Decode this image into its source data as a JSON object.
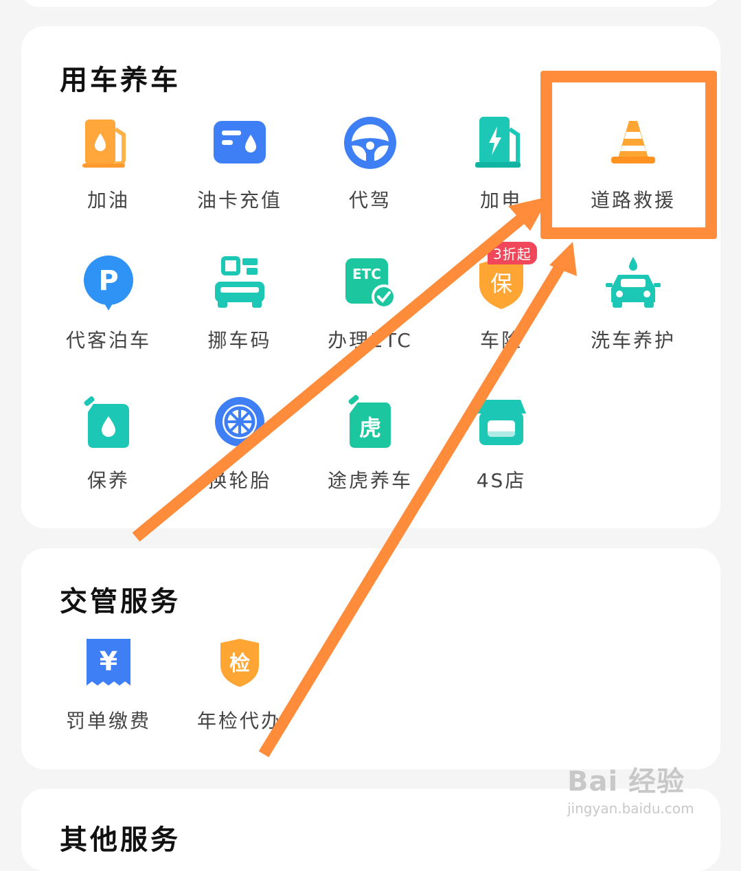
{
  "sections": [
    {
      "title": "用车养车",
      "items": [
        {
          "label": "加油",
          "icon": "fuel-pump-icon"
        },
        {
          "label": "油卡充值",
          "icon": "fuel-card-icon"
        },
        {
          "label": "代驾",
          "icon": "steering-wheel-icon"
        },
        {
          "label": "加电",
          "icon": "charging-station-icon"
        },
        {
          "label": "道路救援",
          "icon": "traffic-cone-icon"
        },
        {
          "label": "代客泊车",
          "icon": "parking-icon"
        },
        {
          "label": "挪车码",
          "icon": "move-car-code-icon"
        },
        {
          "label": "办理ETC",
          "icon": "etc-icon",
          "icon_text": "ETC"
        },
        {
          "label": "车险",
          "icon": "insurance-shield-icon",
          "icon_text": "保",
          "badge": "3折起"
        },
        {
          "label": "洗车养护",
          "icon": "car-wash-icon"
        },
        {
          "label": "保养",
          "icon": "oil-can-icon"
        },
        {
          "label": "换轮胎",
          "icon": "tire-icon"
        },
        {
          "label": "途虎养车",
          "icon": "tuhu-icon",
          "icon_text": "虎"
        },
        {
          "label": "4S店",
          "icon": "store-icon"
        }
      ]
    },
    {
      "title": "交管服务",
      "items": [
        {
          "label": "罚单缴费",
          "icon": "fine-payment-icon",
          "icon_text": "¥"
        },
        {
          "label": "年检代办",
          "icon": "annual-inspection-icon",
          "icon_text": "检"
        }
      ]
    },
    {
      "title": "其他服务",
      "items": []
    }
  ],
  "highlight_color": "#ff8c3b",
  "watermark": {
    "logo": "Bai 经验",
    "url": "jingyan.baidu.com"
  }
}
